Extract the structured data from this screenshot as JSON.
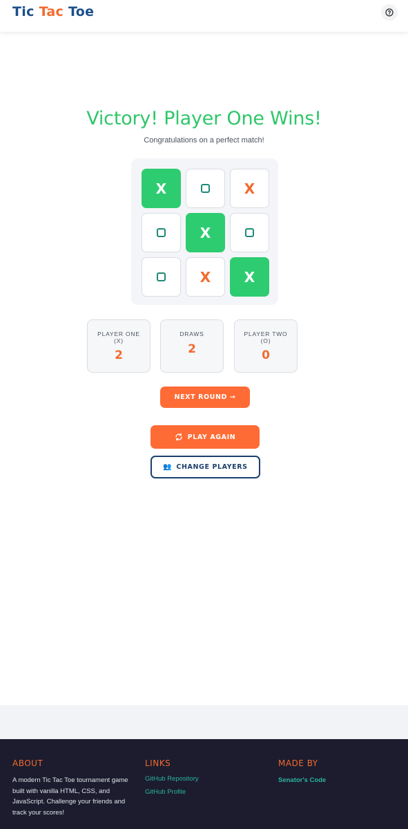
{
  "header": {
    "logo_word_1": "Tic",
    "logo_word_2": "Tac",
    "logo_word_3": "Toe",
    "help_icon": "question-circle-icon"
  },
  "game": {
    "title": "Victory! Player One Wins!",
    "subtitle": "Congratulations on a perfect match!",
    "board": [
      {
        "mark": "X",
        "win": true
      },
      {
        "mark": "O",
        "win": false
      },
      {
        "mark": "X",
        "win": false
      },
      {
        "mark": "O",
        "win": false
      },
      {
        "mark": "X",
        "win": true
      },
      {
        "mark": "O",
        "win": false
      },
      {
        "mark": "O",
        "win": false
      },
      {
        "mark": "X",
        "win": false
      },
      {
        "mark": "X",
        "win": true
      }
    ]
  },
  "scores": {
    "player_one_label_1": "PLAYER ONE",
    "player_one_label_2": "(X)",
    "player_one_value": "2",
    "draws_label": "DRAWS",
    "draws_value": "2",
    "player_two_label_1": "PLAYER TWO",
    "player_two_label_2": "(O)",
    "player_two_value": "0"
  },
  "buttons": {
    "next_round": "NEXT ROUND →",
    "play_again": "PLAY AGAIN",
    "play_again_icon": "refresh-icon",
    "change_players": "CHANGE PLAYERS",
    "change_players_icon": "👥"
  },
  "footer": {
    "about_heading": "ABOUT",
    "about_text": "A modern Tic Tac Toe tournament game built with vanilla HTML, CSS, and JavaScript. Challenge your friends and track your scores!",
    "links_heading": "LINKS",
    "link_1": "GitHub Repository",
    "link_2": "GitHub Profile",
    "made_by_heading": "MADE BY",
    "made_by_name": "Senator's Code"
  },
  "colors": {
    "accent_orange": "#ff6b35",
    "win_green": "#2ecc71",
    "navy": "#1b3f6b",
    "teal": "#2bb39b",
    "footer_bg": "#1c1c2e"
  }
}
